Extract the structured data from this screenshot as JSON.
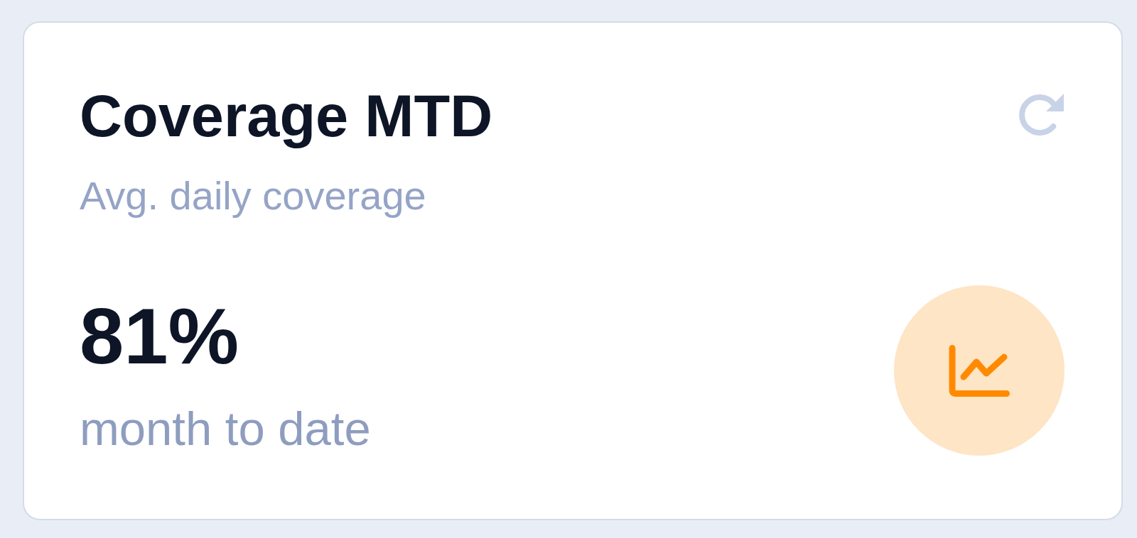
{
  "card": {
    "title": "Coverage MTD",
    "subtitle": "Avg. daily coverage",
    "value": "81%",
    "caption": "month to date"
  }
}
